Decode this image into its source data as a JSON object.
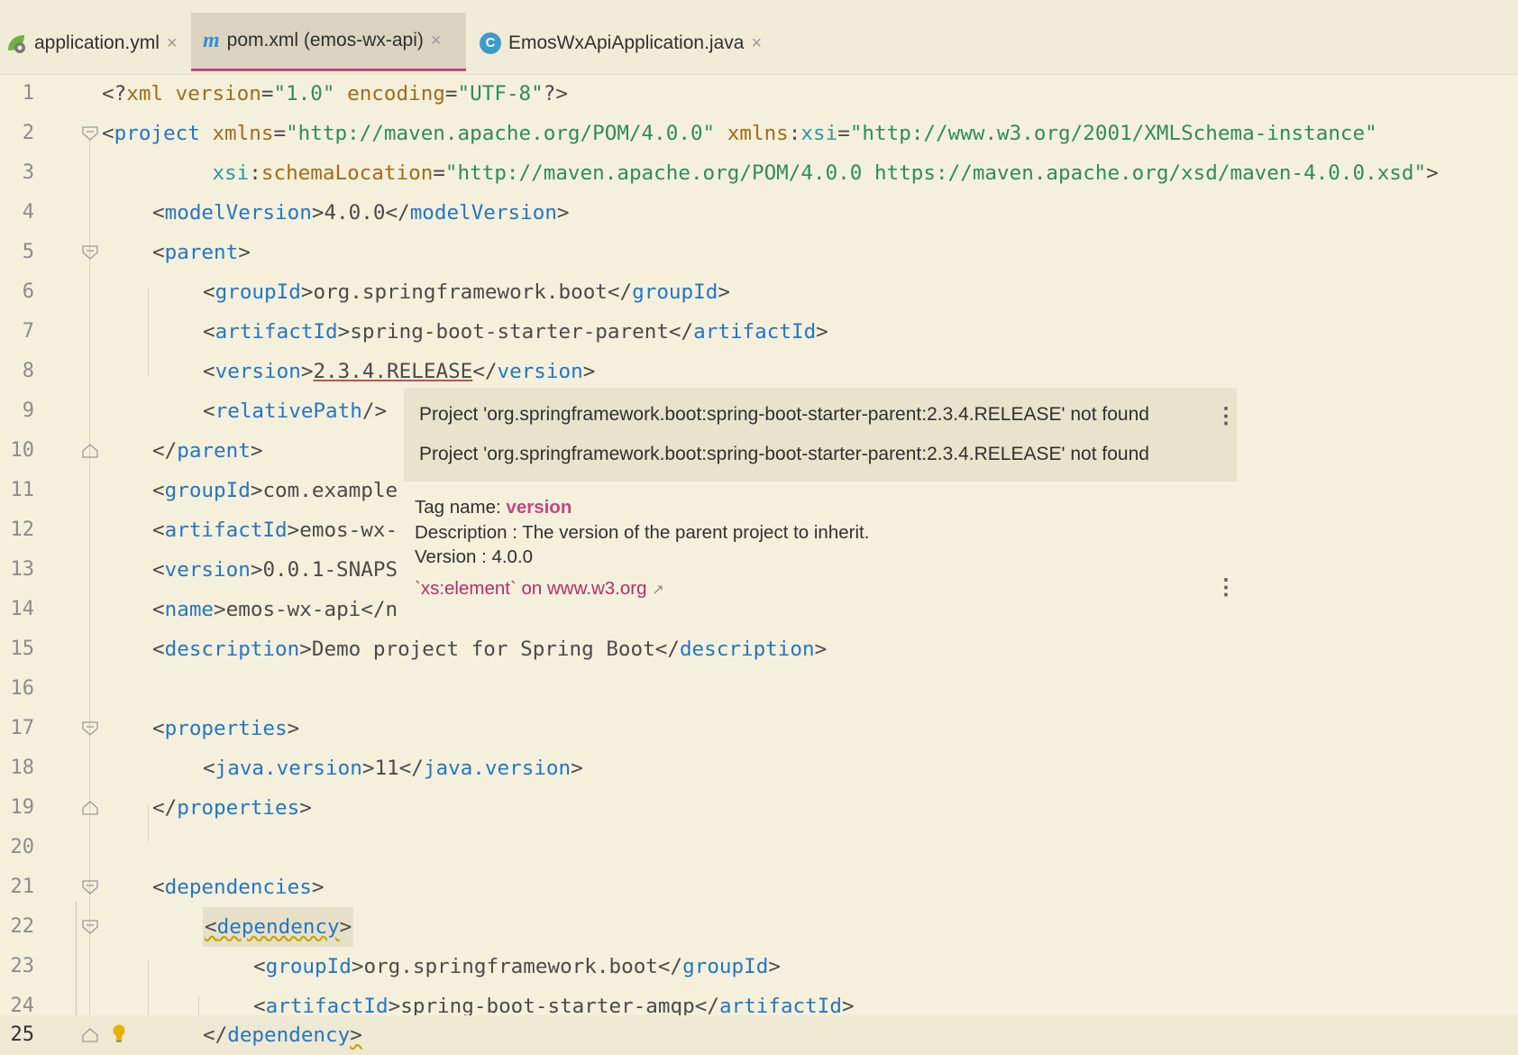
{
  "tabs": [
    {
      "label": "application.yml",
      "icon": "spring-yaml-icon",
      "active": false,
      "close": "×"
    },
    {
      "label": "pom.xml (emos-wx-api)",
      "icon": "maven-icon",
      "active": true,
      "close": "×"
    },
    {
      "label": "EmosWxApiApplication.java",
      "icon": "java-class-icon",
      "active": false,
      "close": "×"
    }
  ],
  "tab_icon_glyphs": {
    "maven": "m",
    "java": "C"
  },
  "line_numbers": [
    "1",
    "2",
    "3",
    "4",
    "5",
    "6",
    "7",
    "8",
    "9",
    "10",
    "11",
    "12",
    "13",
    "14",
    "15",
    "16",
    "17",
    "18",
    "19",
    "20",
    "21",
    "22",
    "23",
    "24",
    "25"
  ],
  "code": {
    "l1": {
      "open": "<?",
      "name": "xml",
      "sp1": " ",
      "a1": "version",
      "eq1": "=",
      "v1": "\"1.0\"",
      "sp2": " ",
      "a2": "encoding",
      "eq2": "=",
      "v2": "\"UTF-8\"",
      "close": "?>"
    },
    "l2": {
      "lt": "<",
      "tag": "project",
      "sp1": " ",
      "a1": "xmlns",
      "eq1": "=",
      "v1": "\"http://maven.apache.org/POM/4.0.0\"",
      "sp2": " ",
      "ns": "xmlns",
      "colon": ":",
      "a2": "xsi",
      "eq2": "=",
      "v2": "\"http://www.w3.org/2001/XMLSchema-instance\""
    },
    "l3": {
      "indent": "         ",
      "ns": "xsi",
      "colon": ":",
      "a": "schemaLocation",
      "eq": "=",
      "v": "\"http://maven.apache.org/POM/4.0.0 https://maven.apache.org/xsd/maven-4.0.0.xsd\"",
      "gt": ">"
    },
    "l4": {
      "tag": "modelVersion",
      "text": "4.0.0"
    },
    "l5": {
      "tag": "parent"
    },
    "l6": {
      "tag": "groupId",
      "text": "org.springframework.boot"
    },
    "l7": {
      "tag": "artifactId",
      "text": "spring-boot-starter-parent"
    },
    "l8": {
      "tag": "version",
      "text": "2.3.4.RELEASE"
    },
    "l9": {
      "tag": "relativePath",
      "selfclose": "/>"
    },
    "l10": {
      "tag": "parent"
    },
    "l11": {
      "tag": "groupId",
      "text": "com.example"
    },
    "l12": {
      "tag": "artifactId",
      "text": "emos-wx-"
    },
    "l13": {
      "tag": "version",
      "text": "0.0.1-SNAPS"
    },
    "l14": {
      "tag": "name",
      "text": "emos-wx-api</n"
    },
    "l15": {
      "tag": "description",
      "text": "Demo project for Spring Boot"
    },
    "l17": {
      "tag": "properties"
    },
    "l18": {
      "tag": "java.version",
      "text": "11"
    },
    "l19": {
      "tag": "properties"
    },
    "l21": {
      "tag": "dependencies"
    },
    "l22": {
      "tag": "dependency"
    },
    "l23": {
      "tag": "groupId",
      "text": "org.springframework.boot"
    },
    "l24": {
      "tag": "artifactId",
      "text": "spring-boot-starter-amqp"
    },
    "l25": {
      "tag": "dependency"
    }
  },
  "syntax": {
    "lt": "<",
    "gt": ">",
    "ltslash": "</"
  },
  "tooltip": {
    "errors": [
      "Project 'org.springframework.boot:spring-boot-starter-parent:2.3.4.RELEASE' not found",
      "Project 'org.springframework.boot:spring-boot-starter-parent:2.3.4.RELEASE' not found"
    ],
    "tag_name_label": "Tag name: ",
    "tag_name": "version",
    "description": "Description : The version of the parent project to inherit.",
    "version": "Version : 4.0.0",
    "link": "`xs:element` on www.w3.org",
    "link_arrow": "↗",
    "kebab": "⋮"
  },
  "colors": {
    "background": "#F5F0DC",
    "tag": "#2476C2",
    "attr": "#A56A1A",
    "value": "#2E8C5A",
    "namespace": "#2B9AA0",
    "active_tab_underline": "#C3477E"
  }
}
